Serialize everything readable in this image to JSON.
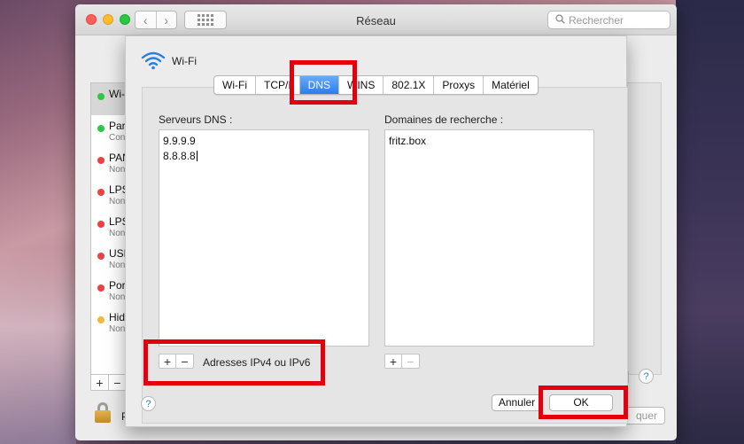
{
  "window": {
    "title": "Réseau",
    "search_placeholder": "Rechercher",
    "lock_text": "P",
    "apply_label": "quer",
    "help_glyph": "?"
  },
  "services": [
    {
      "name": "Wi-",
      "status": "",
      "dot": "#2ec842",
      "selected": true
    },
    {
      "name": "Para",
      "status": "Con",
      "dot": "#2ec842"
    },
    {
      "name": "PAN",
      "status": "Non",
      "dot": "#e9433f"
    },
    {
      "name": "LPS",
      "status": "Non",
      "dot": "#e9433f"
    },
    {
      "name": "LPS",
      "status": "Non",
      "dot": "#e9433f"
    },
    {
      "name": "USE",
      "status": "Non",
      "dot": "#e9433f"
    },
    {
      "name": "Por",
      "status": "Non",
      "dot": "#e9433f"
    },
    {
      "name": "Hid",
      "status": "Non",
      "dot": "#f6b83a"
    }
  ],
  "services_controls": {
    "add": "+",
    "remove": "−"
  },
  "sheet": {
    "interface_title": "Wi-Fi",
    "tabs": [
      {
        "label": "Wi-Fi",
        "active": false
      },
      {
        "label": "TCP/I",
        "active": false
      },
      {
        "label": "DNS",
        "active": true
      },
      {
        "label": "WINS",
        "active": false
      },
      {
        "label": "802.1X",
        "active": false
      },
      {
        "label": "Proxys",
        "active": false
      },
      {
        "label": "Matériel",
        "active": false
      }
    ],
    "dns_servers_label": "Serveurs DNS :",
    "dns_servers": [
      "9.9.9.9",
      "8.8.8.8"
    ],
    "search_domains_label": "Domaines de recherche :",
    "search_domains": [
      "fritz.box"
    ],
    "ipv_label": "Adresses IPv4 ou IPv6",
    "add": "+",
    "remove": "−",
    "cancel_label": "Annuler",
    "ok_label": "OK",
    "help_glyph": "?"
  },
  "colors": {
    "highlight": "#e2000f",
    "tab_active": "#2a7df0",
    "help_blue": "#2a7de1"
  }
}
